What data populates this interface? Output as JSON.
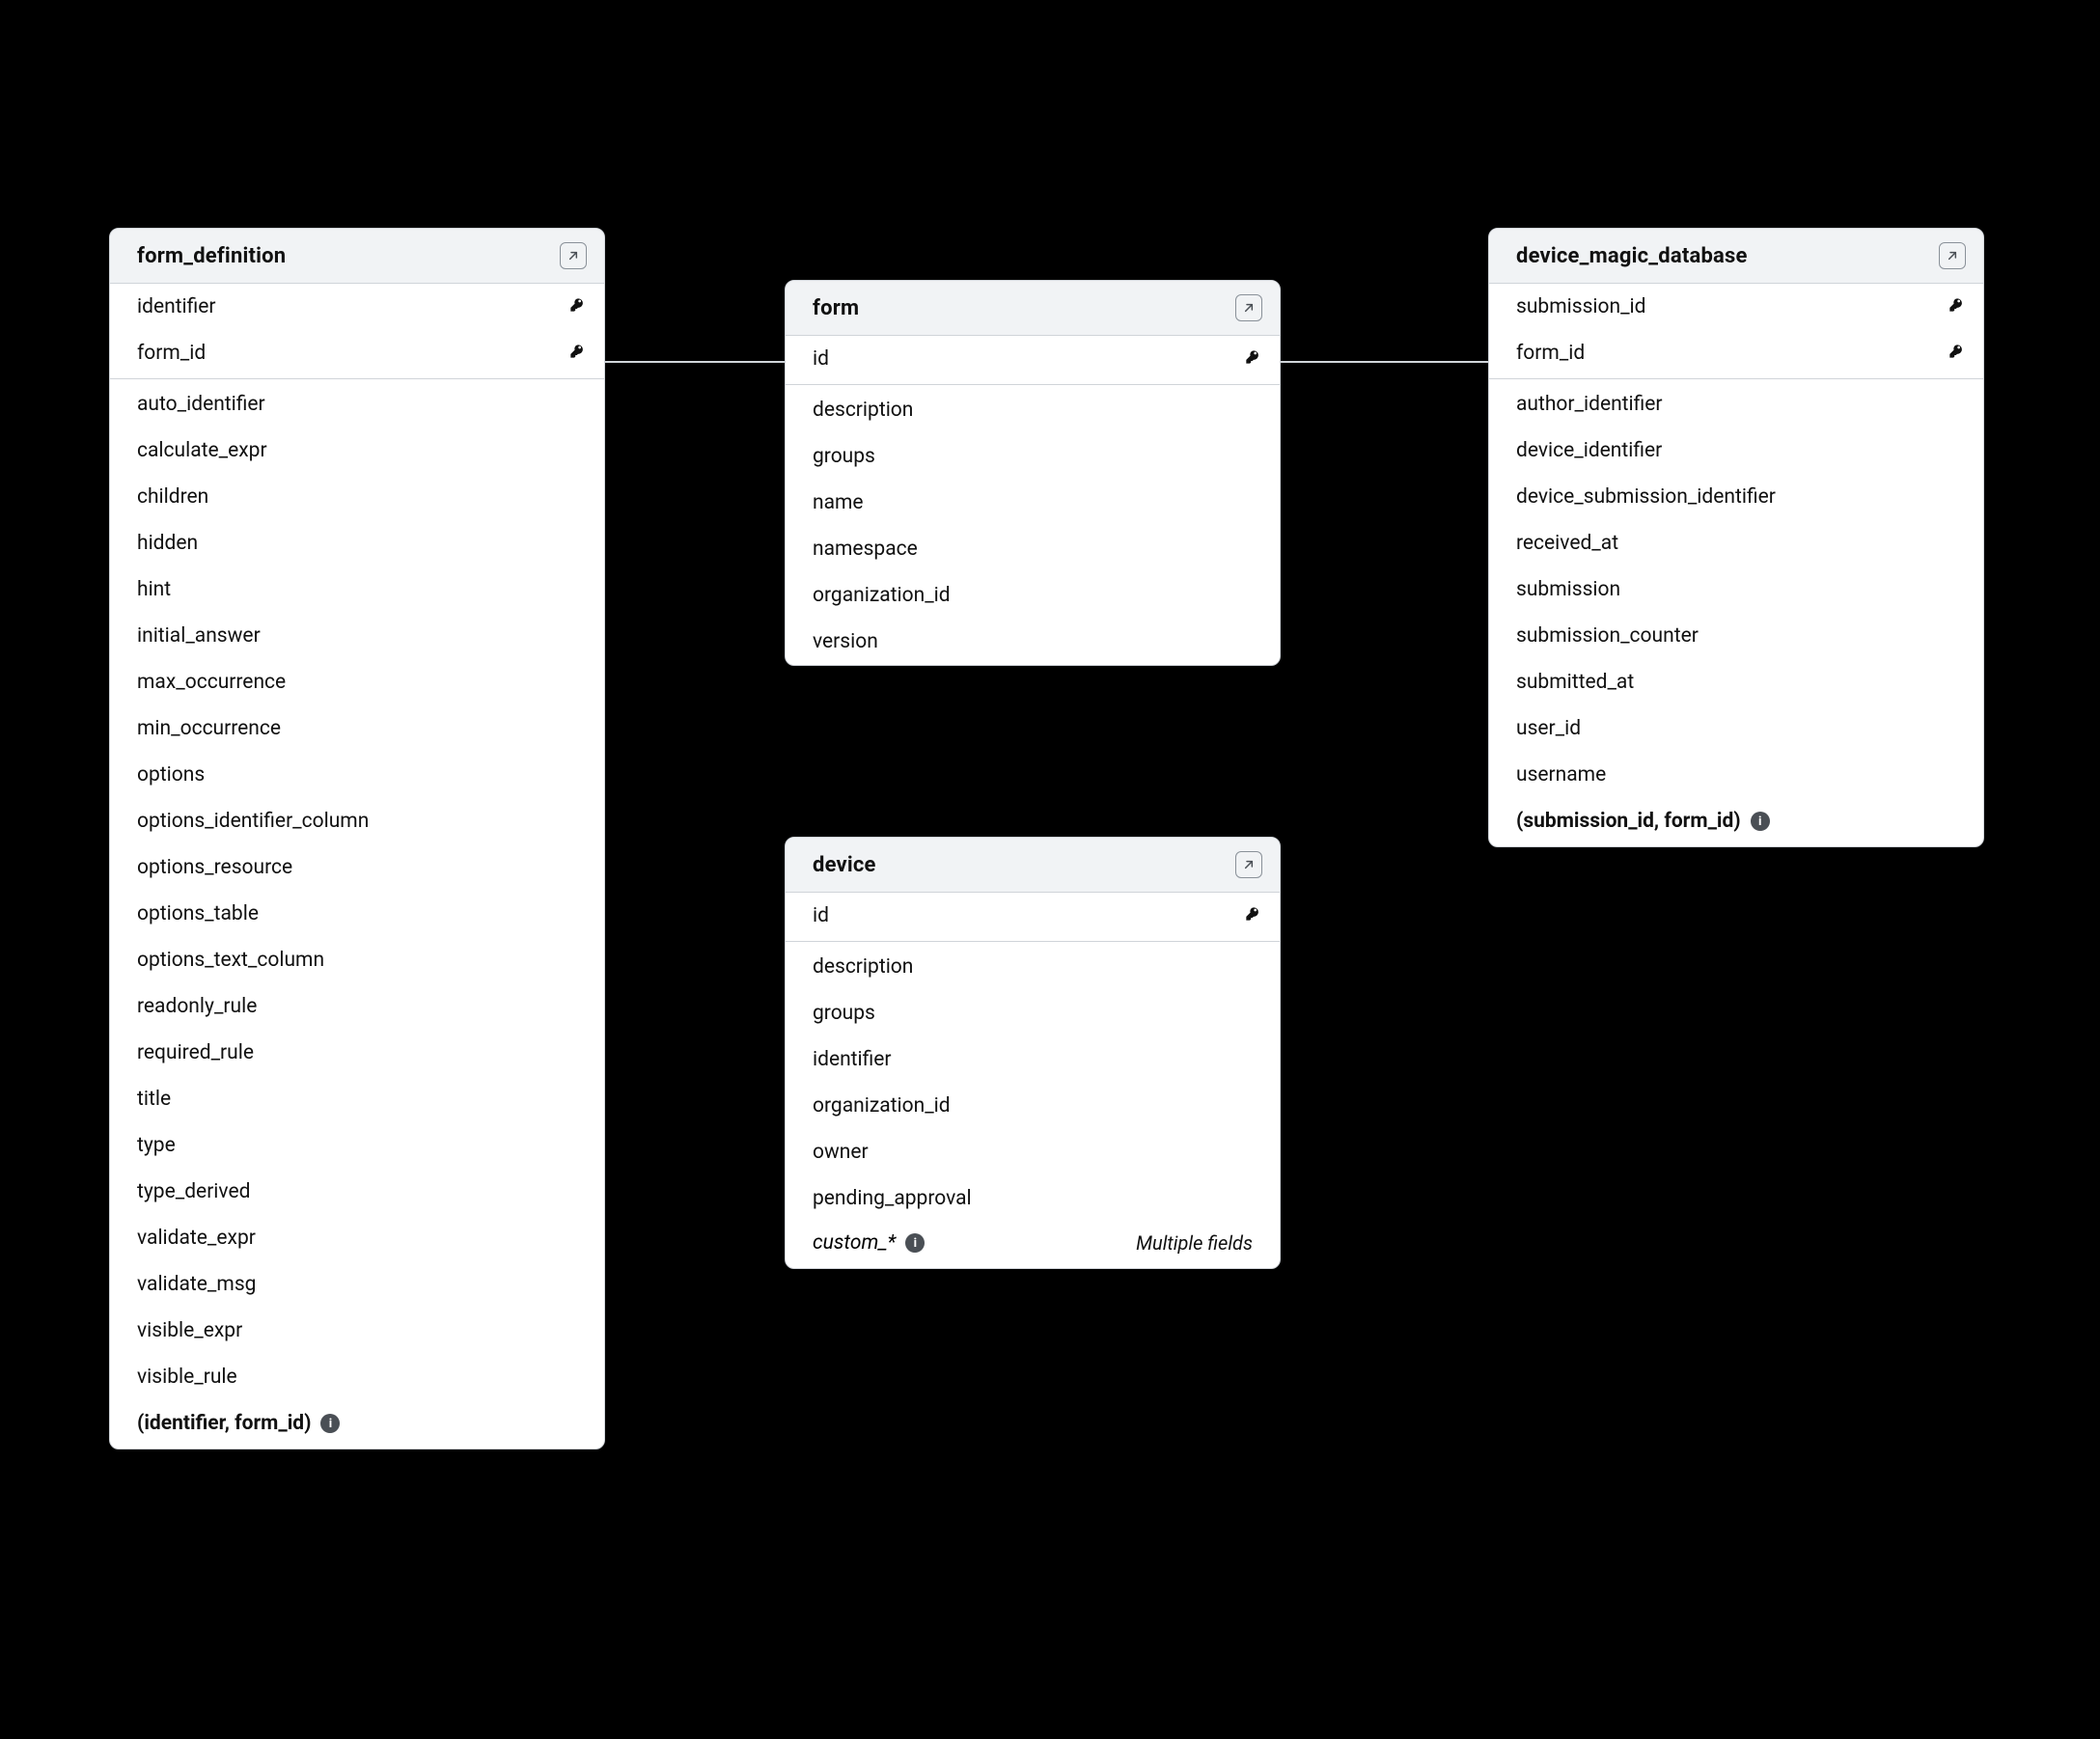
{
  "entities": {
    "form_definition": {
      "title": "form_definition",
      "keys": [
        "identifier",
        "form_id"
      ],
      "fields": [
        "auto_identifier",
        "calculate_expr",
        "children",
        "hidden",
        "hint",
        "initial_answer",
        "max_occurrence",
        "min_occurrence",
        "options",
        "options_identifier_column",
        "options_resource",
        "options_table",
        "options_text_column",
        "readonly_rule",
        "required_rule",
        "title",
        "type",
        "type_derived",
        "validate_expr",
        "validate_msg",
        "visible_expr",
        "visible_rule"
      ],
      "footer": "(identifier, form_id)"
    },
    "form": {
      "title": "form",
      "keys": [
        "id"
      ],
      "fields": [
        "description",
        "groups",
        "name",
        "namespace",
        "organization_id",
        "version"
      ]
    },
    "device": {
      "title": "device",
      "keys": [
        "id"
      ],
      "fields": [
        "description",
        "groups",
        "identifier",
        "organization_id",
        "owner",
        "pending_approval"
      ],
      "custom_field": "custom_*",
      "custom_note": "Multiple fields"
    },
    "device_magic_database": {
      "title": "device_magic_database",
      "keys": [
        "submission_id",
        "form_id"
      ],
      "fields": [
        "author_identifier",
        "device_identifier",
        "device_submission_identifier",
        "received_at",
        "submission",
        "submission_counter",
        "submitted_at",
        "user_id",
        "username"
      ],
      "footer": "(submission_id, form_id)"
    }
  }
}
